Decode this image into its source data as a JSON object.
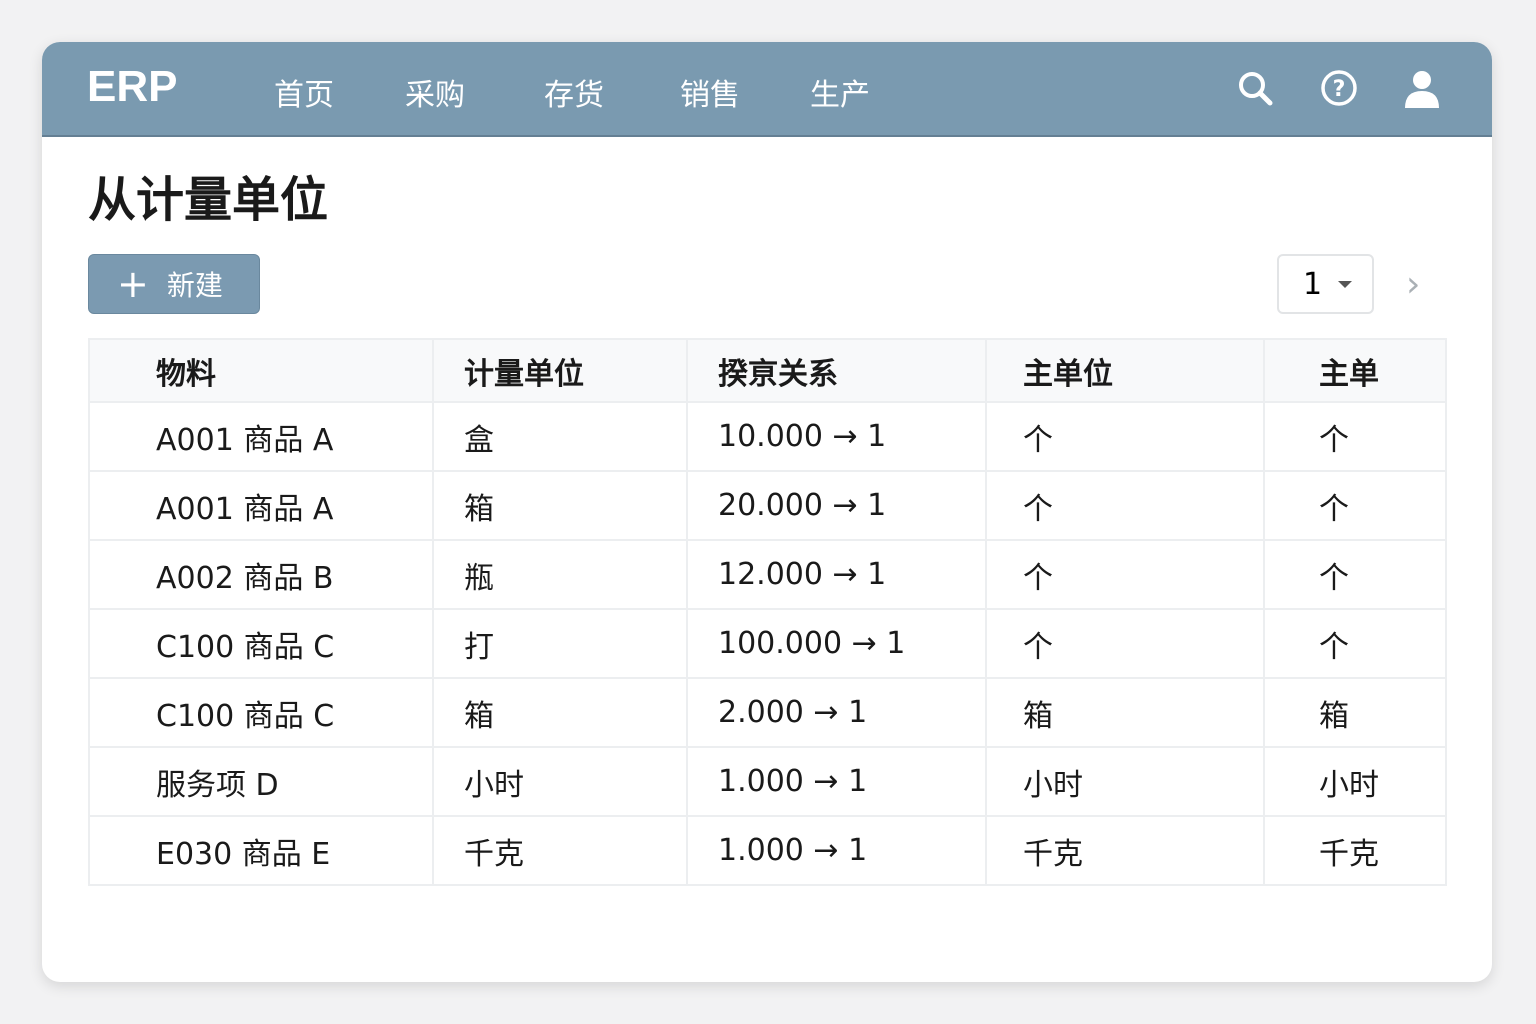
{
  "nav": {
    "logo": "ERP",
    "items": [
      "首页",
      "采购",
      "存货",
      "销售",
      "生产"
    ]
  },
  "page": {
    "title": "从计量单位",
    "new_label": "新建",
    "page_value": "1"
  },
  "table": {
    "headers": [
      "物料",
      "计量单位",
      "揆亰关系",
      "主单位",
      "主单"
    ],
    "rows": [
      [
        "A001 商品 A",
        "盒",
        "10.000 → 1",
        "个",
        "个"
      ],
      [
        "A001 商品 A",
        "箱",
        "20.000 → 1",
        "个",
        "个"
      ],
      [
        "A002 商品 B",
        "瓶",
        "12.000 → 1",
        "个",
        "个"
      ],
      [
        "C100 商品 C",
        "打",
        "100.000 → 1",
        "个",
        "个"
      ],
      [
        "C100 商品 C",
        "箱",
        "2.000 → 1",
        "箱",
        "箱"
      ],
      [
        "服务项 D",
        "小时",
        "1.000 → 1",
        "小时",
        "小时"
      ],
      [
        "E030 商品 E",
        "千克",
        "1.000 → 1",
        "千克",
        "千克"
      ]
    ]
  }
}
